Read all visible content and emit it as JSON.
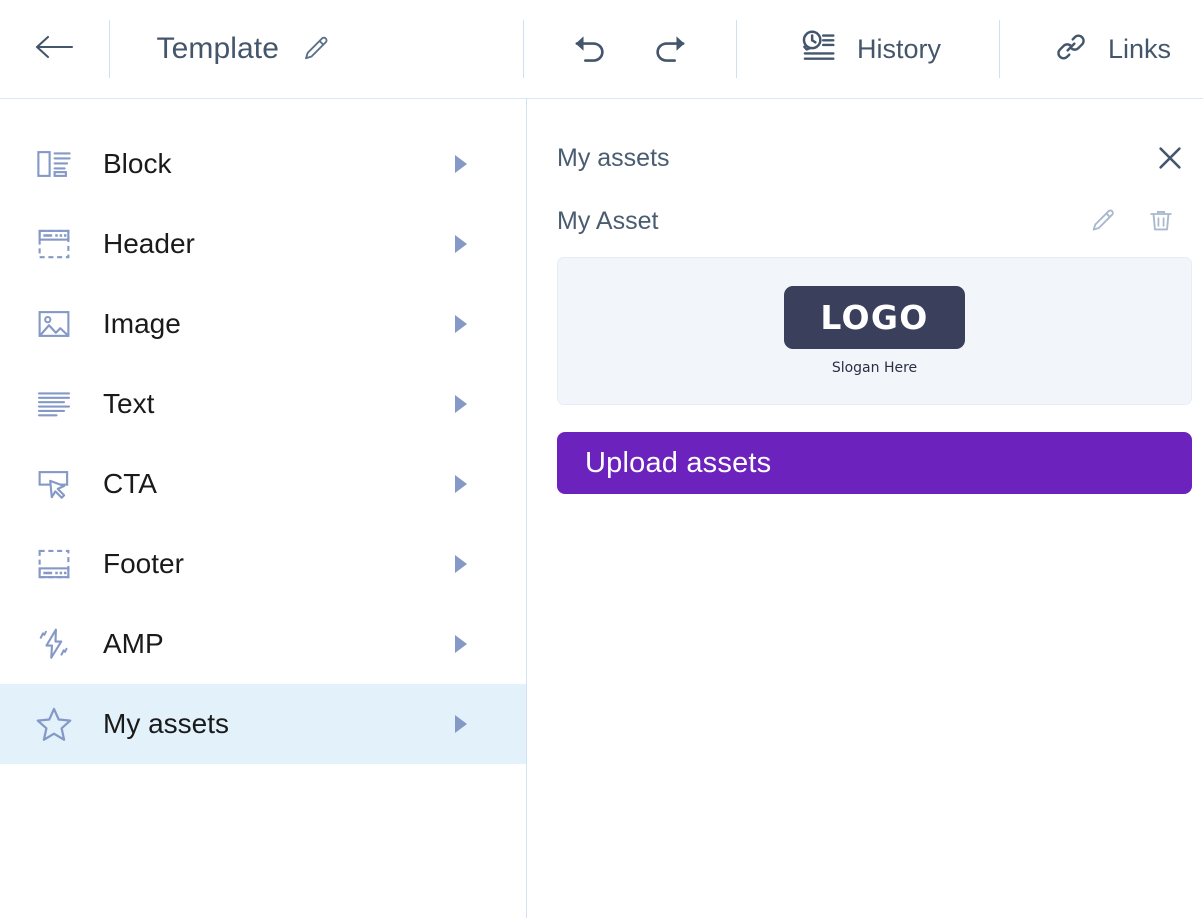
{
  "topbar": {
    "back_icon": "arrow-left-icon",
    "title": "Template",
    "edit_icon": "pencil-icon",
    "undo_icon": "undo-arrow-icon",
    "redo_icon": "redo-arrow-icon",
    "history": {
      "label": "History",
      "icon": "history-clock-list-icon"
    },
    "links": {
      "label": "Links",
      "icon": "link-chain-icon"
    }
  },
  "sidebar": {
    "items": [
      {
        "label": "Block",
        "icon": "block-layout-icon",
        "active": false
      },
      {
        "label": "Header",
        "icon": "header-layout-icon",
        "active": false
      },
      {
        "label": "Image",
        "icon": "image-picture-icon",
        "active": false
      },
      {
        "label": "Text",
        "icon": "text-lines-icon",
        "active": false
      },
      {
        "label": "CTA",
        "icon": "cta-cursor-icon",
        "active": false
      },
      {
        "label": "Footer",
        "icon": "footer-layout-icon",
        "active": false
      },
      {
        "label": "AMP",
        "icon": "amp-lightning-icon",
        "active": false
      },
      {
        "label": "My assets",
        "icon": "star-icon",
        "active": true
      }
    ],
    "caret_icon": "caret-right-icon"
  },
  "panel": {
    "title": "My assets",
    "close_icon": "close-x-icon",
    "asset": {
      "name": "My Asset",
      "edit_icon": "pencil-icon",
      "delete_icon": "trash-icon",
      "preview": {
        "logo_text": "LOGO",
        "slogan": "Slogan Here"
      }
    },
    "upload_button": {
      "label": "Upload assets"
    }
  },
  "colors": {
    "accent_purple": "#6c22bd",
    "active_row": "#e3f1fb",
    "icon_blue": "#8599c6",
    "text_slate": "#44566c",
    "logo_navy": "#3a3f5c"
  }
}
